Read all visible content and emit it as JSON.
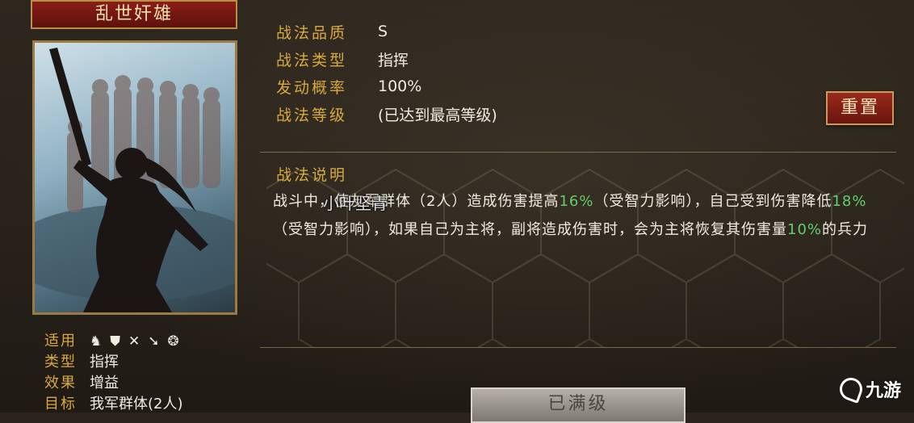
{
  "skill": {
    "name": "乱世奸雄",
    "attributes": [
      {
        "label": "战法品质",
        "value": "S"
      },
      {
        "label": "战法类型",
        "value": "指挥"
      },
      {
        "label": "发动概率",
        "value": "100%"
      },
      {
        "label": "战法等级",
        "value": "(已达到最高等级)"
      }
    ],
    "reset_label": "重置",
    "description_title": "战法说明",
    "description": {
      "p1": "战斗中，使友军群体（2人）造成伤害提高",
      "h1": "16%",
      "p2": "（受智力影响），自己受到伤害降低",
      "h2": "18%",
      "p3": "（受智力影响），如果自己为主将，副将造成伤害时，会为主将恢复其伤害量",
      "h3": "10%",
      "p4": "的兵力"
    },
    "maxed_label": "已满级"
  },
  "meta": {
    "rows": [
      {
        "label": "适用",
        "icons": [
          "cavalry-icon",
          "shield-icon",
          "bow-icon",
          "spear-icon",
          "siege-icon"
        ]
      },
      {
        "label": "类型",
        "value": "指挥"
      },
      {
        "label": "效果",
        "value": "增益"
      },
      {
        "label": "目标",
        "value": "我军群体(2人)"
      }
    ]
  },
  "overlay": {
    "watermark": "小叶坚青",
    "logo_text": "九游"
  },
  "colors": {
    "accent_gold": "#d8a93e",
    "highlight_green": "#5fcf6c",
    "title_red": "#8a1e16"
  }
}
